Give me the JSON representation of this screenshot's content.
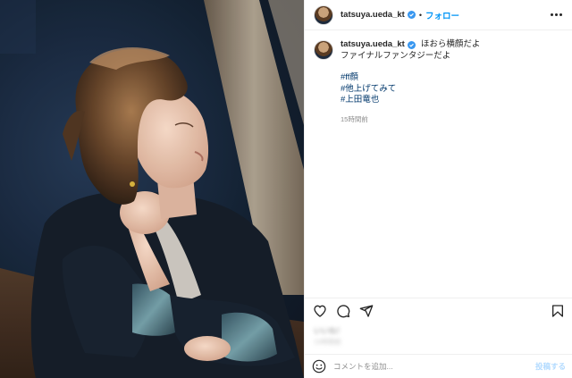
{
  "post": {
    "username": "tatsuya.ueda_kt",
    "follow_label": "フォロー",
    "separator": "•",
    "caption_text": "ほおら横顔だよ",
    "caption_line2": "ファイナルファンタジーだよ",
    "hashtags": [
      "#ff顔",
      "#他上げてみて",
      "#上田竜也"
    ],
    "time_ago": "15時間前",
    "likes_text": "いいね！",
    "likes_subtext": "15時間前"
  },
  "icons": {
    "verified": "verified-badge-icon",
    "more": "more-options-icon",
    "like": "heart-icon",
    "comment": "comment-icon",
    "share": "send-icon",
    "save": "bookmark-icon",
    "emoji": "emoji-icon"
  },
  "comment_box": {
    "placeholder": "コメントを追加...",
    "post_label": "投稿する"
  },
  "colors": {
    "link": "#0095f6",
    "hashtag": "#00376b",
    "verified": "#3897f0",
    "muted": "#8e8e8e",
    "post_disabled": "#b3dbff"
  }
}
